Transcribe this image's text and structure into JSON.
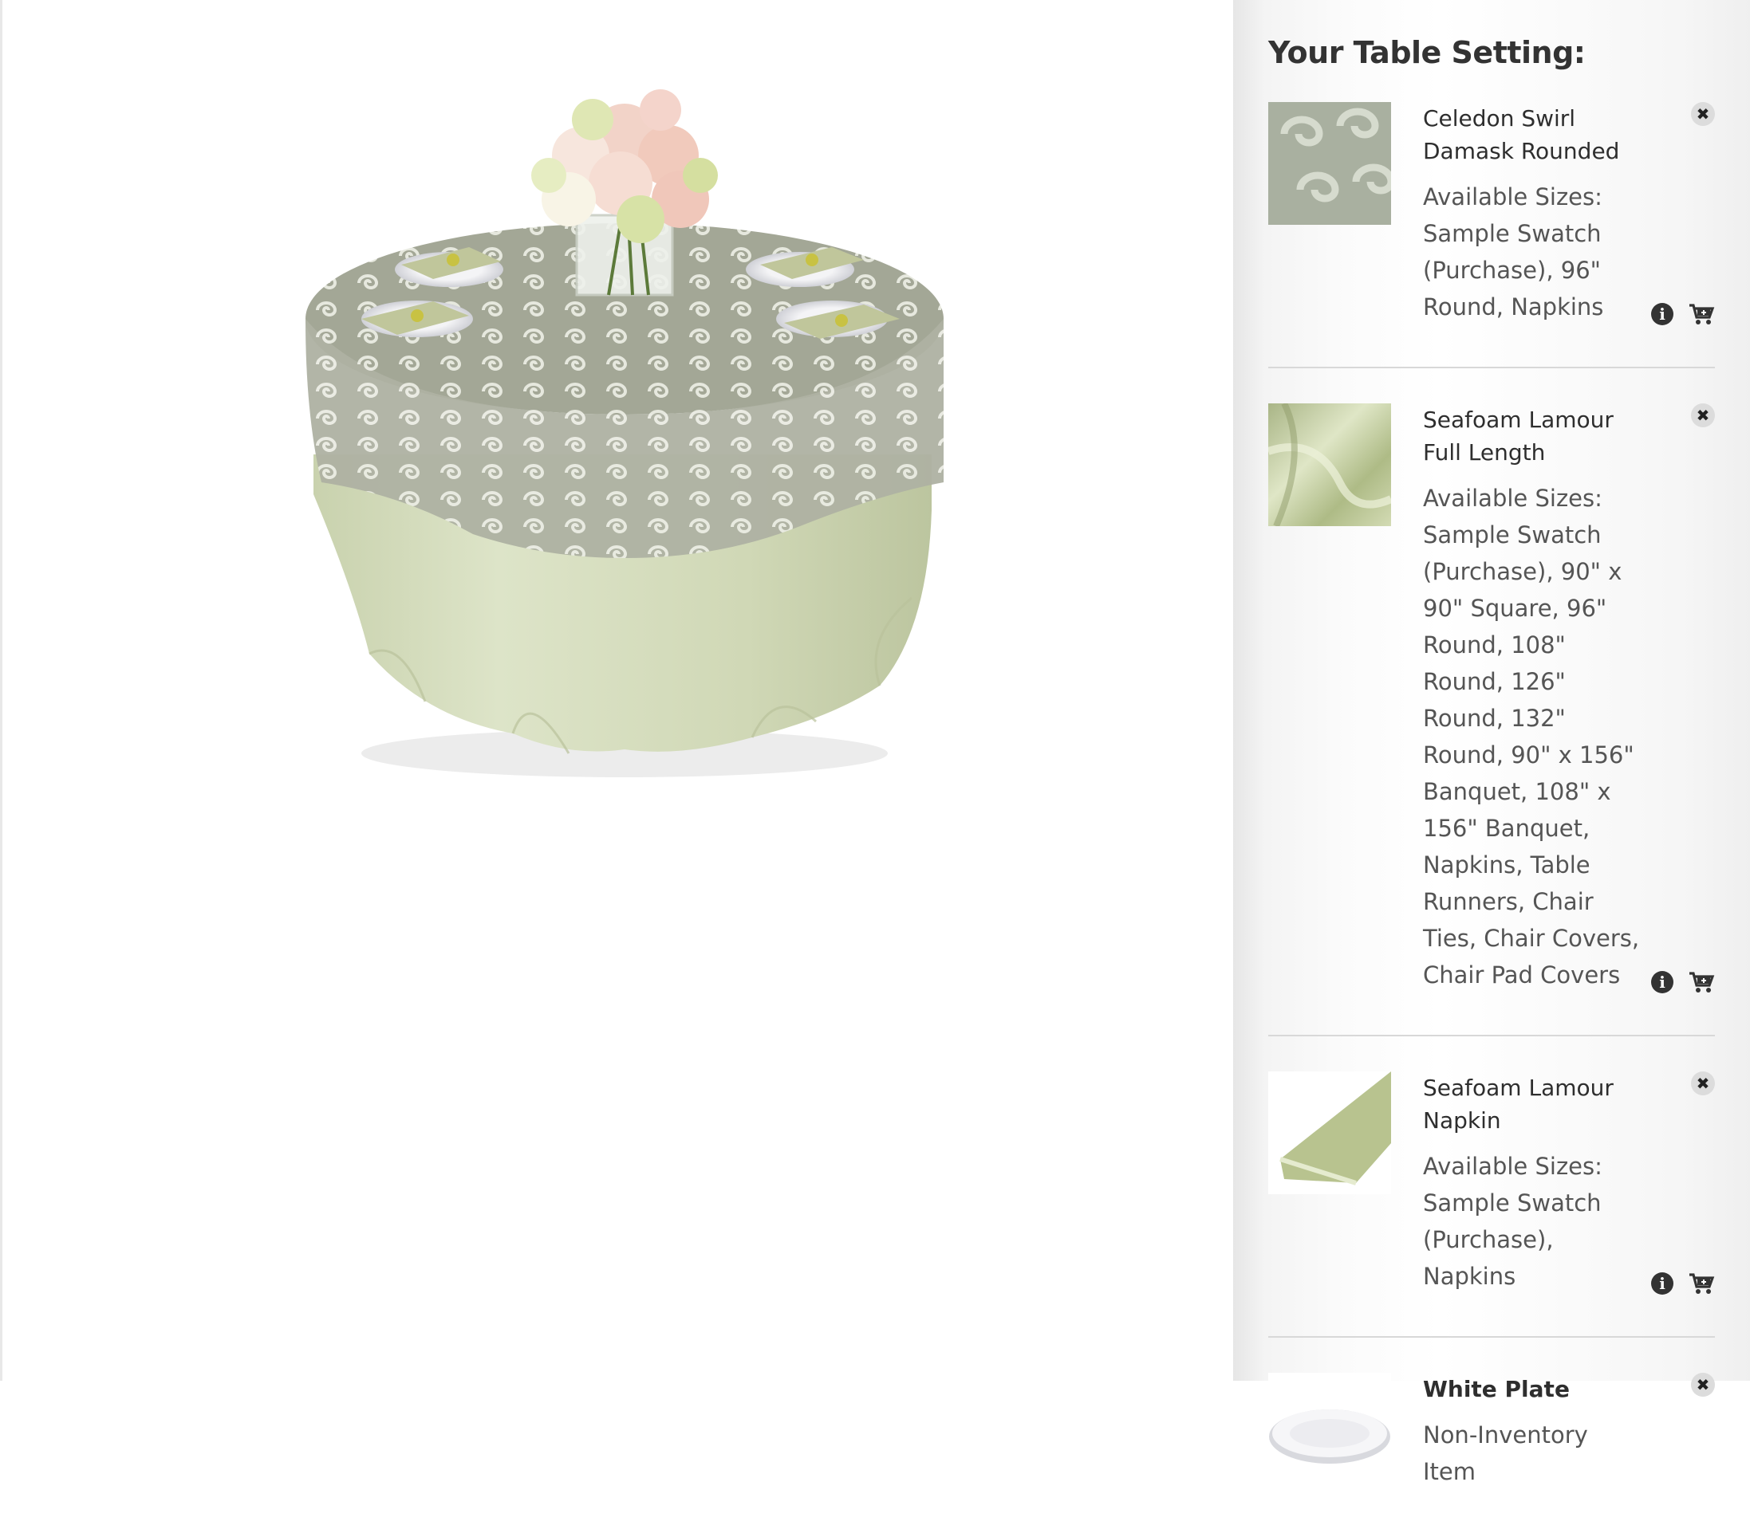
{
  "panel": {
    "title": "Your Table Setting:",
    "items": [
      {
        "name": "Celedon Swirl Damask Rounded",
        "sizes": "Available Sizes: Sample Swatch (Purchase), 96\" Round, Napkins",
        "thumb": "celedon-swirl-swatch"
      },
      {
        "name": "Seafoam Lamour Full Length",
        "sizes": "Available Sizes: Sample Swatch (Purchase), 90\" x 90\" Square, 96\" Round, 108\" Round, 126\" Round, 132\" Round, 90\" x 156\" Banquet, 108\" x 156\" Banquet, Napkins, Table Runners, Chair Ties, Chair Covers, Chair Pad Covers",
        "thumb": "seafoam-satin-swatch"
      },
      {
        "name": "Seafoam Lamour Napkin",
        "sizes": "Available Sizes: Sample Swatch (Purchase), Napkins",
        "thumb": "seafoam-napkin"
      },
      {
        "name": "White Plate",
        "sizes": "Non-Inventory Item",
        "thumb": "white-plate"
      }
    ]
  },
  "colors": {
    "tablecloth": "#d4dcbd",
    "overlay": "#9ea393",
    "swirl": "#e4e6dc"
  }
}
